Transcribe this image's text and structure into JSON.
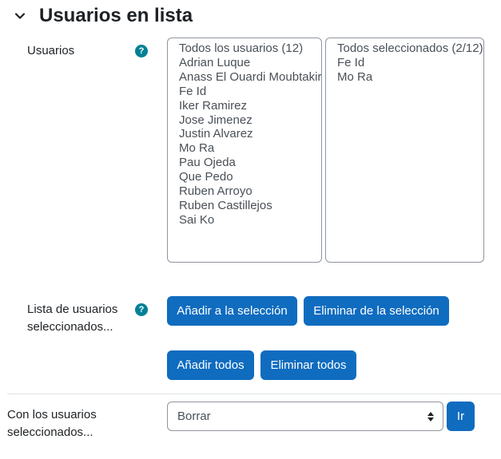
{
  "section": {
    "title": "Usuarios en lista",
    "toggle_icon": "chevron-down-icon"
  },
  "users_field": {
    "label": "Usuarios",
    "help_glyph": "?",
    "available": [
      "Todos los usuarios (12)",
      "Adrian Luque",
      "Anass El Ouardi Moubtakir",
      "Fe Id",
      "Iker Ramirez",
      "Jose Jimenez",
      "Justin Alvarez",
      "Mo Ra",
      "Pau Ojeda",
      "Que Pedo",
      "Ruben Arroyo",
      "Ruben Castillejos",
      "Sai Ko"
    ],
    "selected": [
      "Todos seleccionados (2/12)",
      "Fe Id",
      "Mo Ra"
    ]
  },
  "selected_list_field": {
    "label_line1": "Lista de usuarios",
    "label_line2": "seleccionados...",
    "help_glyph": "?",
    "buttons": {
      "add_selection": "Añadir a la selección",
      "remove_selection": "Eliminar de la selección",
      "add_all": "Añadir todos",
      "remove_all": "Eliminar todos"
    }
  },
  "action_field": {
    "label_line1": "Con los usuarios",
    "label_line2": "seleccionados...",
    "select_value": "Borrar",
    "go_button": "Ir"
  },
  "colors": {
    "primary": "#0f6cbf",
    "help": "#008196",
    "text": "#1d2125"
  }
}
